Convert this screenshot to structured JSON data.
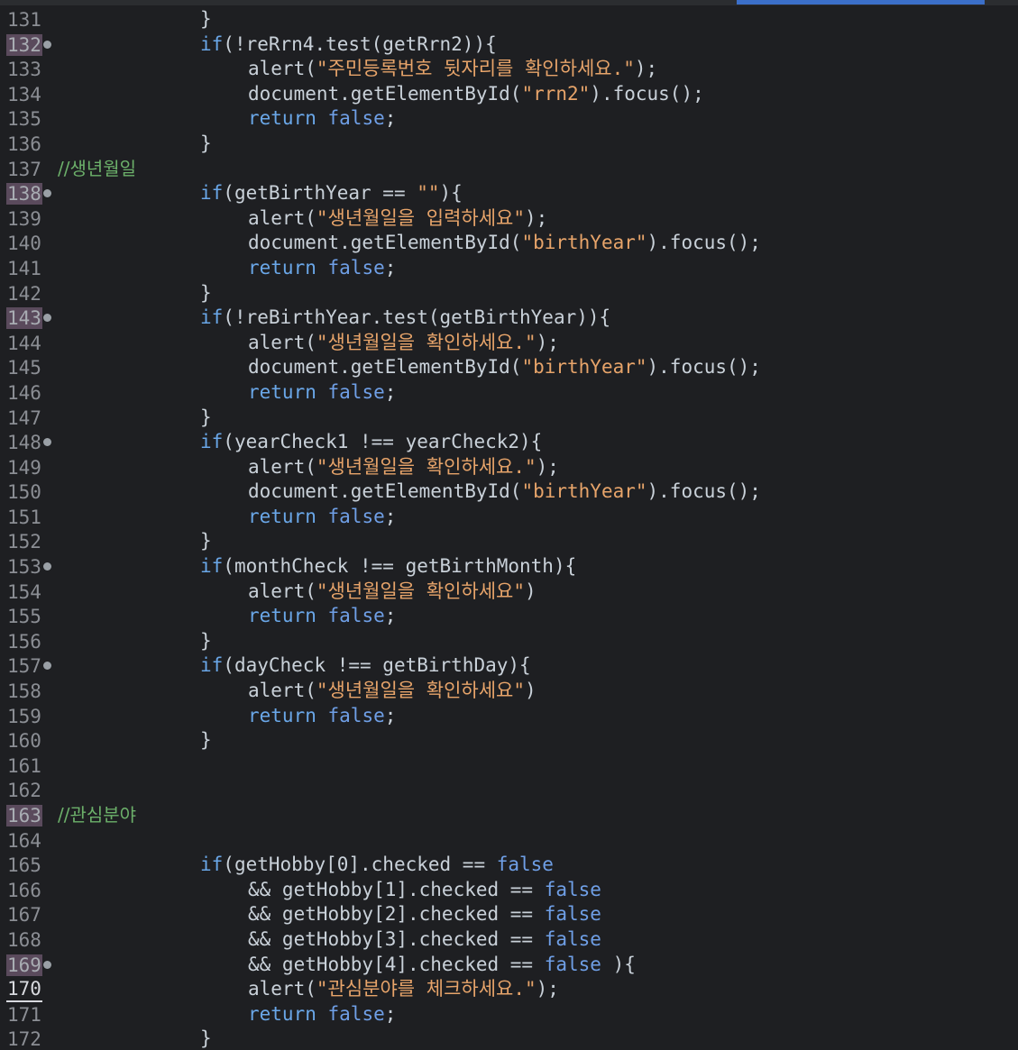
{
  "editor": {
    "lines": [
      {
        "n": "131",
        "indent": 1,
        "tokens": [
          {
            "t": "}",
            "c": "plain"
          }
        ]
      },
      {
        "n": "132",
        "hl": true,
        "fold": true,
        "indent": 1,
        "tokens": [
          {
            "t": "if",
            "c": "kw"
          },
          {
            "t": "(!reRrn4.test(getRrn2)){",
            "c": "plain"
          }
        ]
      },
      {
        "n": "133",
        "indent": 2,
        "tokens": [
          {
            "t": "alert(",
            "c": "plain"
          },
          {
            "t": "\"주민등록번호 뒷자리를 확인하세요.\"",
            "c": "str"
          },
          {
            "t": ");",
            "c": "plain"
          }
        ]
      },
      {
        "n": "134",
        "indent": 2,
        "tokens": [
          {
            "t": "document.getElementById(",
            "c": "plain"
          },
          {
            "t": "\"rrn2\"",
            "c": "str"
          },
          {
            "t": ").focus();",
            "c": "plain"
          }
        ]
      },
      {
        "n": "135",
        "indent": 2,
        "tokens": [
          {
            "t": "return ",
            "c": "kw"
          },
          {
            "t": "false",
            "c": "kw bool"
          },
          {
            "t": ";",
            "c": "plain"
          }
        ]
      },
      {
        "n": "136",
        "indent": 1,
        "tokens": [
          {
            "t": "}",
            "c": "plain"
          }
        ]
      },
      {
        "n": "137",
        "indent": 0,
        "tokens": [
          {
            "t": "//생년월일",
            "c": "cmt"
          }
        ]
      },
      {
        "n": "138",
        "hl": true,
        "fold": true,
        "indent": 1,
        "tokens": [
          {
            "t": "if",
            "c": "kw"
          },
          {
            "t": "(getBirthYear == ",
            "c": "plain"
          },
          {
            "t": "\"\"",
            "c": "str"
          },
          {
            "t": "){",
            "c": "plain"
          }
        ]
      },
      {
        "n": "139",
        "indent": 2,
        "tokens": [
          {
            "t": "alert(",
            "c": "plain"
          },
          {
            "t": "\"생년월일을 입력하세요\"",
            "c": "str"
          },
          {
            "t": ");",
            "c": "plain"
          }
        ]
      },
      {
        "n": "140",
        "indent": 2,
        "tokens": [
          {
            "t": "document.getElementById(",
            "c": "plain"
          },
          {
            "t": "\"birthYear\"",
            "c": "str"
          },
          {
            "t": ").focus();",
            "c": "plain"
          }
        ]
      },
      {
        "n": "141",
        "indent": 2,
        "tokens": [
          {
            "t": "return ",
            "c": "kw"
          },
          {
            "t": "false",
            "c": "kw bool"
          },
          {
            "t": ";",
            "c": "plain"
          }
        ]
      },
      {
        "n": "142",
        "indent": 1,
        "tokens": [
          {
            "t": "}",
            "c": "plain"
          }
        ]
      },
      {
        "n": "143",
        "hl": true,
        "fold": true,
        "indent": 1,
        "tokens": [
          {
            "t": "if",
            "c": "kw"
          },
          {
            "t": "(!reBirthYear.test(getBirthYear)){",
            "c": "plain"
          }
        ]
      },
      {
        "n": "144",
        "indent": 2,
        "tokens": [
          {
            "t": "alert(",
            "c": "plain"
          },
          {
            "t": "\"생년월일을 확인하세요.\"",
            "c": "str"
          },
          {
            "t": ");",
            "c": "plain"
          }
        ]
      },
      {
        "n": "145",
        "indent": 2,
        "tokens": [
          {
            "t": "document.getElementById(",
            "c": "plain"
          },
          {
            "t": "\"birthYear\"",
            "c": "str"
          },
          {
            "t": ").focus();",
            "c": "plain"
          }
        ]
      },
      {
        "n": "146",
        "indent": 2,
        "tokens": [
          {
            "t": "return ",
            "c": "kw"
          },
          {
            "t": "false",
            "c": "kw bool"
          },
          {
            "t": ";",
            "c": "plain"
          }
        ]
      },
      {
        "n": "147",
        "indent": 1,
        "tokens": [
          {
            "t": "}",
            "c": "plain"
          }
        ]
      },
      {
        "n": "148",
        "fold": true,
        "indent": 1,
        "tokens": [
          {
            "t": "if",
            "c": "kw"
          },
          {
            "t": "(yearCheck1 !== yearCheck2){",
            "c": "plain"
          }
        ]
      },
      {
        "n": "149",
        "indent": 2,
        "tokens": [
          {
            "t": "alert(",
            "c": "plain"
          },
          {
            "t": "\"생년월일을 확인하세요.\"",
            "c": "str"
          },
          {
            "t": ");",
            "c": "plain"
          }
        ]
      },
      {
        "n": "150",
        "indent": 2,
        "tokens": [
          {
            "t": "document.getElementById(",
            "c": "plain"
          },
          {
            "t": "\"birthYear\"",
            "c": "str"
          },
          {
            "t": ").focus();",
            "c": "plain"
          }
        ]
      },
      {
        "n": "151",
        "indent": 2,
        "tokens": [
          {
            "t": "return ",
            "c": "kw"
          },
          {
            "t": "false",
            "c": "kw bool"
          },
          {
            "t": ";",
            "c": "plain"
          }
        ]
      },
      {
        "n": "152",
        "indent": 1,
        "tokens": [
          {
            "t": "}",
            "c": "plain"
          }
        ]
      },
      {
        "n": "153",
        "fold": true,
        "indent": 1,
        "tokens": [
          {
            "t": "if",
            "c": "kw"
          },
          {
            "t": "(monthCheck !== getBirthMonth){",
            "c": "plain"
          }
        ]
      },
      {
        "n": "154",
        "indent": 2,
        "tokens": [
          {
            "t": "alert(",
            "c": "plain"
          },
          {
            "t": "\"생년월일을 확인하세요\"",
            "c": "str"
          },
          {
            "t": ")",
            "c": "plain"
          }
        ]
      },
      {
        "n": "155",
        "indent": 2,
        "tokens": [
          {
            "t": "return ",
            "c": "kw"
          },
          {
            "t": "false",
            "c": "kw bool"
          },
          {
            "t": ";",
            "c": "plain"
          }
        ]
      },
      {
        "n": "156",
        "indent": 1,
        "tokens": [
          {
            "t": "}",
            "c": "plain"
          }
        ]
      },
      {
        "n": "157",
        "fold": true,
        "indent": 1,
        "tokens": [
          {
            "t": "if",
            "c": "kw"
          },
          {
            "t": "(dayCheck !== getBirthDay){",
            "c": "plain"
          }
        ]
      },
      {
        "n": "158",
        "indent": 2,
        "tokens": [
          {
            "t": "alert(",
            "c": "plain"
          },
          {
            "t": "\"생년월일을 확인하세요\"",
            "c": "str"
          },
          {
            "t": ")",
            "c": "plain"
          }
        ]
      },
      {
        "n": "159",
        "indent": 2,
        "tokens": [
          {
            "t": "return ",
            "c": "kw"
          },
          {
            "t": "false",
            "c": "kw bool"
          },
          {
            "t": ";",
            "c": "plain"
          }
        ]
      },
      {
        "n": "160",
        "indent": 1,
        "tokens": [
          {
            "t": "}",
            "c": "plain"
          }
        ]
      },
      {
        "n": "161",
        "indent": 0,
        "tokens": []
      },
      {
        "n": "162",
        "indent": 0,
        "tokens": []
      },
      {
        "n": "163",
        "hl": true,
        "indent": 0,
        "tokens": [
          {
            "t": "//관심분야",
            "c": "cmt"
          }
        ]
      },
      {
        "n": "164",
        "indent": 0,
        "tokens": []
      },
      {
        "n": "165",
        "indent": 1,
        "tokens": [
          {
            "t": "if",
            "c": "kw"
          },
          {
            "t": "(getHobby[0].checked == ",
            "c": "plain"
          },
          {
            "t": "false",
            "c": "kw bool"
          }
        ]
      },
      {
        "n": "166",
        "indent": 2,
        "tokens": [
          {
            "t": "&& getHobby[1].checked == ",
            "c": "plain"
          },
          {
            "t": "false",
            "c": "kw bool"
          }
        ]
      },
      {
        "n": "167",
        "indent": 2,
        "tokens": [
          {
            "t": "&& getHobby[2].checked == ",
            "c": "plain"
          },
          {
            "t": "false",
            "c": "kw bool"
          }
        ]
      },
      {
        "n": "168",
        "indent": 2,
        "tokens": [
          {
            "t": "&& getHobby[3].checked == ",
            "c": "plain"
          },
          {
            "t": "false",
            "c": "kw bool"
          }
        ]
      },
      {
        "n": "169",
        "hl": true,
        "fold": true,
        "indent": 2,
        "tokens": [
          {
            "t": "&& getHobby[4].checked == ",
            "c": "plain"
          },
          {
            "t": "false",
            "c": "kw bool"
          },
          {
            "t": " ){",
            "c": "plain"
          }
        ]
      },
      {
        "n": "170",
        "cur": true,
        "indent": 2,
        "tokens": [
          {
            "t": "alert(",
            "c": "plain"
          },
          {
            "t": "\"관심분야를 체크하세요.\"",
            "c": "str"
          },
          {
            "t": ");",
            "c": "plain"
          }
        ]
      },
      {
        "n": "171",
        "indent": 2,
        "tokens": [
          {
            "t": "return ",
            "c": "kw"
          },
          {
            "t": "false",
            "c": "kw bool"
          },
          {
            "t": ";",
            "c": "plain"
          }
        ]
      },
      {
        "n": "172",
        "indent": 1,
        "tokens": [
          {
            "t": "}",
            "c": "plain"
          }
        ]
      }
    ]
  }
}
